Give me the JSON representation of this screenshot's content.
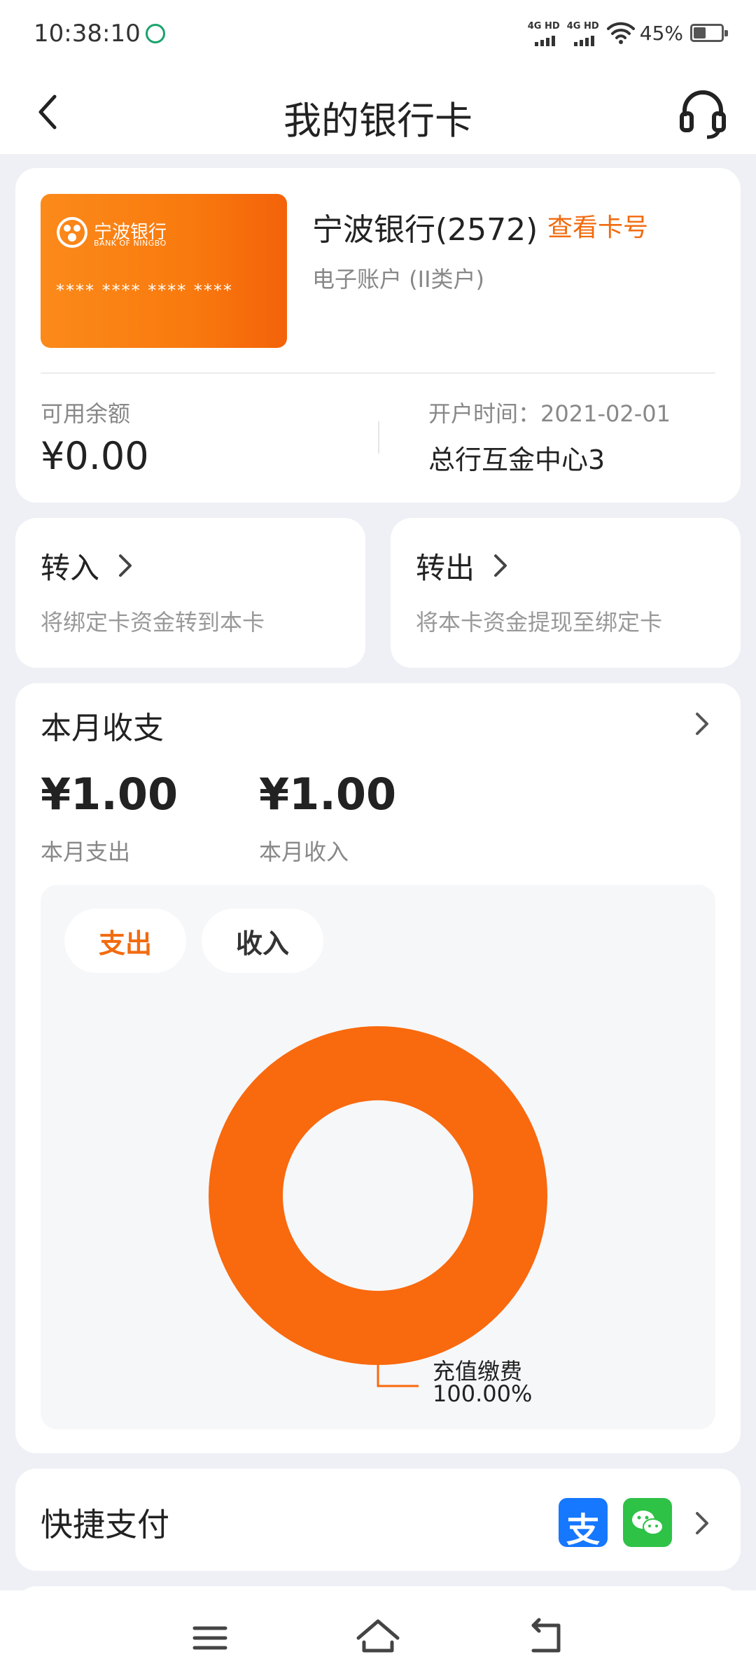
{
  "status_bar": {
    "time": "10:38:10",
    "network1": "4G HD",
    "network2": "4G HD",
    "battery": "45%"
  },
  "header": {
    "title": "我的银行卡"
  },
  "card": {
    "logo_cn": "宁波银行",
    "logo_en": "BANK OF NINGBO",
    "masked_number": "**** **** **** ****",
    "bank_name": "宁波银行(2572)",
    "view_card_number": "查看卡号",
    "account_type": "电子账户 (II类户)",
    "balance_label": "可用余额",
    "balance": "¥0.00",
    "open_label": "开户时间：2021-02-01",
    "branch": "总行互金中心3"
  },
  "actions": {
    "transfer_in": {
      "title": "转入",
      "subtitle": "将绑定卡资金转到本卡"
    },
    "transfer_out": {
      "title": "转出",
      "subtitle": "将本卡资金提现至绑定卡"
    }
  },
  "monthly": {
    "title": "本月收支",
    "expense_amount": "¥1.00",
    "expense_label": "本月支出",
    "income_amount": "¥1.00",
    "income_label": "本月收入",
    "tabs": {
      "expense": "支出",
      "income": "收入"
    }
  },
  "chart_data": {
    "type": "pie",
    "categories": [
      "充值缴费"
    ],
    "values": [
      100
    ],
    "labels": [
      "100.00%"
    ],
    "colors": [
      "#f9690e"
    ]
  },
  "quick_pay": {
    "title": "快捷支付",
    "alipay_glyph": "支"
  },
  "colors": {
    "accent": "#f26b0f",
    "alipay": "#1677ff",
    "wechat": "#2ec247"
  }
}
